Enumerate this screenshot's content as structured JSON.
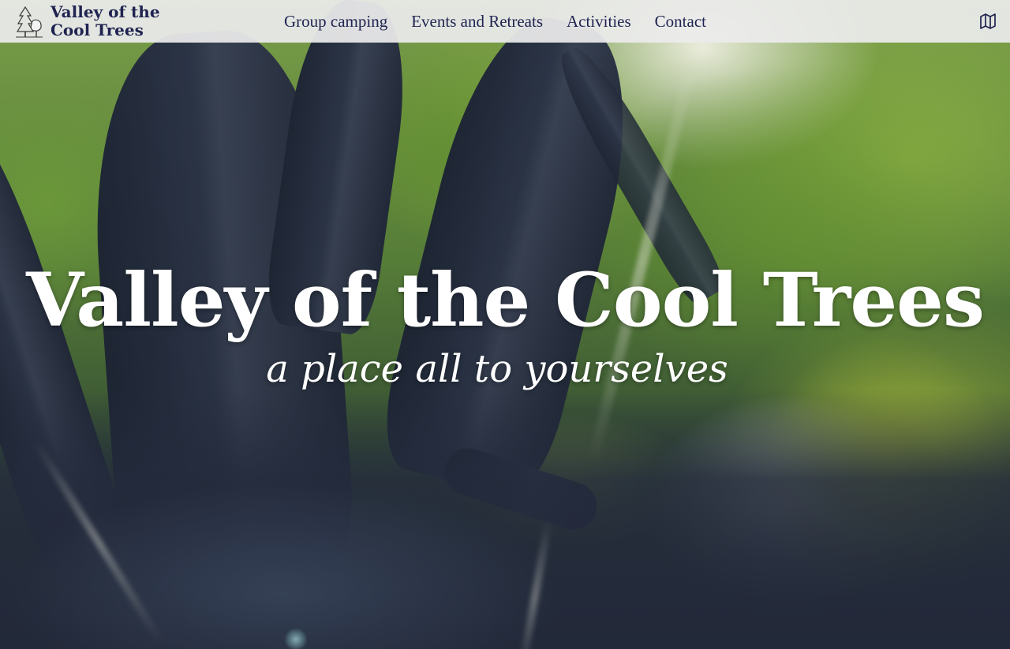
{
  "site": {
    "brand_name": "Valley of the Cool Trees",
    "logo_icon": "tree-logo-icon"
  },
  "nav": {
    "items": [
      {
        "label": "Group camping"
      },
      {
        "label": "Events and Retreats"
      },
      {
        "label": "Activities"
      },
      {
        "label": "Contact"
      }
    ],
    "map_icon": "map-icon"
  },
  "hero": {
    "title": "Valley of the Cool Trees",
    "tagline": "a place all to yourselves",
    "background": "forest canopy video with sun flare"
  },
  "colors": {
    "header_bg": "#ececec",
    "nav_text": "#1f2350",
    "hero_text": "#ffffff"
  }
}
